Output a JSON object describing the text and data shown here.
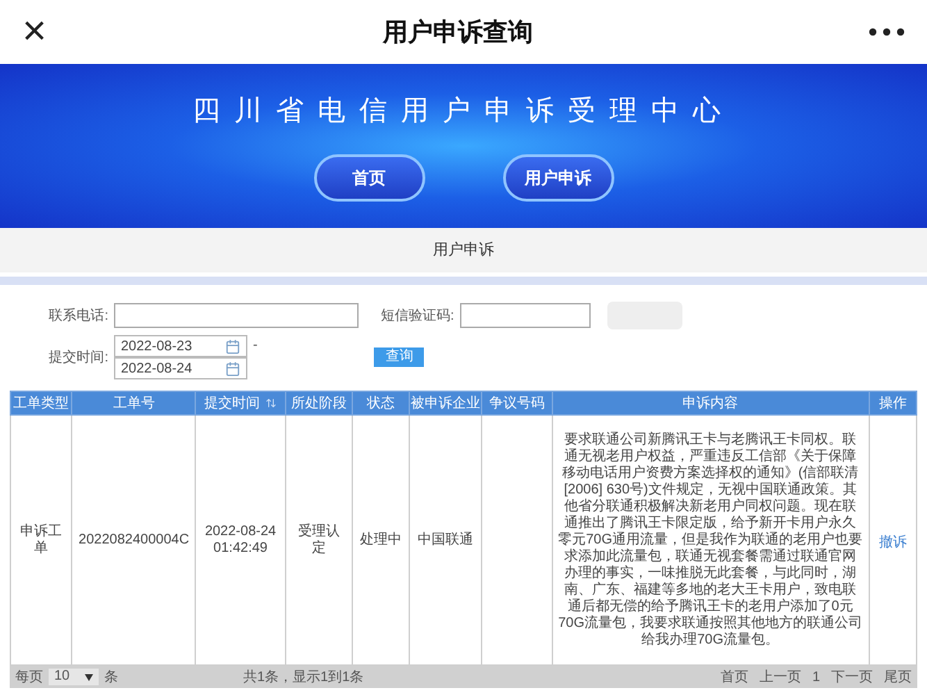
{
  "top_bar": {
    "close": "×",
    "title": "用户申诉查询"
  },
  "banner": {
    "title": "四川省电信用户申诉受理中心",
    "buttons": [
      {
        "label": "首页"
      },
      {
        "label": "用户申诉"
      }
    ]
  },
  "breadcrumb": "用户申诉",
  "form": {
    "phone_label": "联系电话:",
    "code_label": "短信验证码:",
    "date_label": "提交时间:",
    "date_from": "2022-08-23",
    "date_to": "2022-08-24",
    "range_sep": "-",
    "query_button": "查询"
  },
  "table": {
    "columns": [
      {
        "label": "工单类型",
        "sortable": false
      },
      {
        "label": "工单号",
        "sortable": false
      },
      {
        "label": "提交时间",
        "sortable": true
      },
      {
        "label": "所处阶段",
        "sortable": false
      },
      {
        "label": "状态",
        "sortable": false
      },
      {
        "label": "被申诉企业",
        "sortable": false
      },
      {
        "label": "争议号码",
        "sortable": false
      },
      {
        "label": "申诉内容",
        "sortable": false
      },
      {
        "label": "操作",
        "sortable": false
      }
    ],
    "rows": [
      {
        "type": "申诉工单",
        "number": "2022082400004C",
        "time": "2022-08-24 01:42:49",
        "stage": "受理认定",
        "status": "处理中",
        "company": "中国联通",
        "content": "要求联通公司新腾讯王卡与老腾讯王卡同权。联通无视老用户权益，严重违反工信部《关于保障移动电话用户资费方案选择权的通知》(信部联清[2006] 630号)文件规定，无视中国联通政策。其他省分联通积极解决新老用户同权问题。现在联通推出了腾讯王卡限定版，给予新开卡用户永久零元70G通用流量，但是我作为联通的老用户也要求添加此流量包，联通无视套餐需通过联通官网办理的事实，一味推脱无此套餐，与此同时，湖南、广东、福建等多地的老大王卡用户，致电联通后都无偿的给予腾讯王卡的老用户添加了0元70G流量包，我要求联通按照其他地方的联通公司给我办理70G流量包。",
        "action": "撤诉"
      }
    ]
  },
  "pager": {
    "per_page_label": "每页",
    "per_page": "10",
    "per_page_unit": "条",
    "summary": "共1条，显示1到1条",
    "links": [
      "首页",
      "上一页",
      "1",
      "下一页",
      "尾页"
    ]
  }
}
